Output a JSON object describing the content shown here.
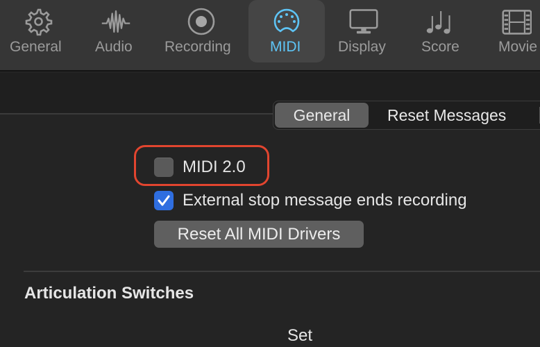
{
  "toolbar": {
    "items": [
      {
        "label": "General",
        "icon": "gear-icon",
        "active": false
      },
      {
        "label": "Audio",
        "icon": "waveform-icon",
        "active": false
      },
      {
        "label": "Recording",
        "icon": "record-icon",
        "active": false
      },
      {
        "label": "MIDI",
        "icon": "midi-connector-icon",
        "active": true
      },
      {
        "label": "Display",
        "icon": "monitor-icon",
        "active": false
      },
      {
        "label": "Score",
        "icon": "music-notes-icon",
        "active": false
      },
      {
        "label": "Movie",
        "icon": "film-strip-icon",
        "active": false
      }
    ],
    "accent_color": "#5ec4f5"
  },
  "tabs": {
    "items": [
      {
        "label": "General",
        "selected": true
      },
      {
        "label": "Reset Messages",
        "selected": false
      }
    ]
  },
  "options": {
    "midi2": {
      "label": "MIDI 2.0",
      "checked": false
    },
    "external_stop": {
      "label": "External stop message ends recording",
      "checked": true
    },
    "reset_button": "Reset All MIDI Drivers"
  },
  "highlight_color": "#e2452f",
  "articulation": {
    "title": "Articulation Switches",
    "column_label": "Set"
  }
}
